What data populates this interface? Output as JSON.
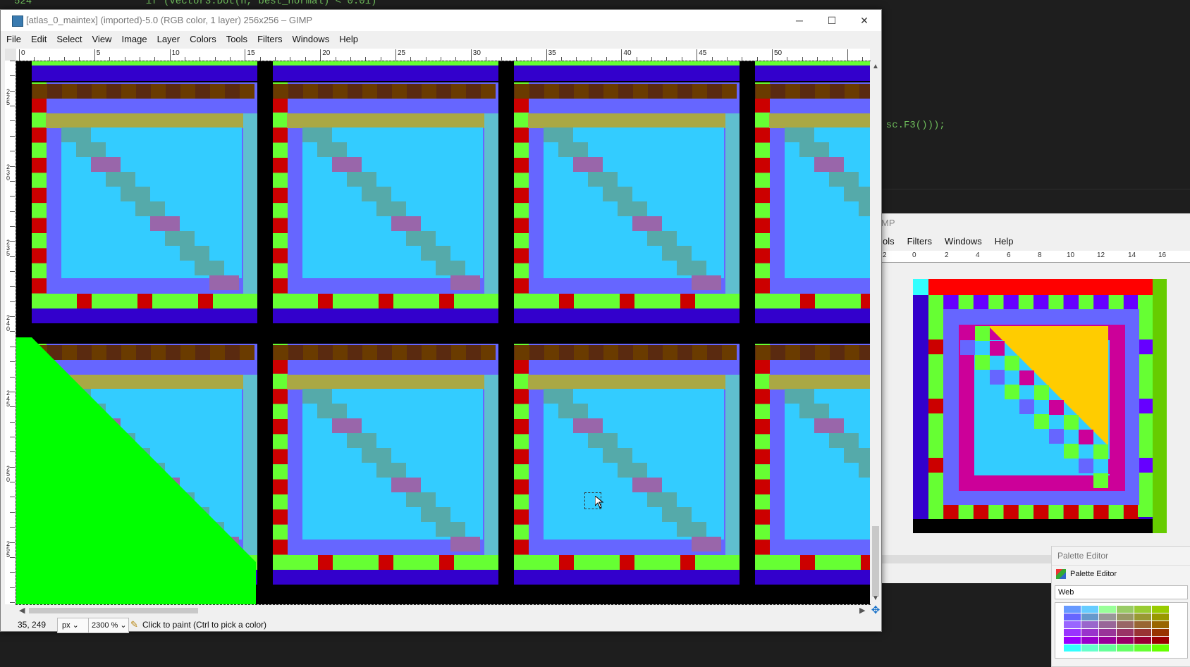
{
  "background_code": {
    "line1": "  if (Vector3.Dot(n, best_normal) < 0.01)",
    "line2": ", sc.F3()));",
    "line_number": "524"
  },
  "main_window": {
    "title": "[atlas_0_maintex] (imported)-5.0 (RGB color, 1 layer) 256x256 – GIMP",
    "minimize": "─",
    "maximize": "☐",
    "close": "✕",
    "menu": [
      "File",
      "Edit",
      "Select",
      "View",
      "Image",
      "Layer",
      "Colors",
      "Tools",
      "Filters",
      "Windows",
      "Help"
    ],
    "ruler_h_labels": [
      "0",
      "5",
      "10",
      "15",
      "20",
      "25",
      "30",
      "35",
      "40",
      "45",
      "50"
    ],
    "ruler_v_labels": [
      "225",
      "230",
      "235",
      "240",
      "245",
      "250",
      "255"
    ],
    "status": {
      "coords": "35, 249",
      "unit": "px",
      "zoom": "2300 %",
      "message": "Click to paint (Ctrl to pick a color)"
    }
  },
  "second_window": {
    "title": "MP",
    "menu": [
      "ols",
      "Filters",
      "Windows",
      "Help"
    ],
    "ruler_labels": [
      "2",
      "0",
      "2",
      "4",
      "6",
      "8",
      "10",
      "12",
      "14",
      "16"
    ]
  },
  "palette_editor": {
    "title": "Palette Editor",
    "tab_label": "Palette Editor",
    "palette_name": "Web"
  },
  "colors": {
    "black": "#000000",
    "lime": "#66ff33",
    "red": "#cc0000",
    "blue": "#3300cc",
    "cyan": "#33ccff",
    "periwinkle": "#6666ff",
    "green": "#00ff00",
    "teal": "#55cccc"
  }
}
